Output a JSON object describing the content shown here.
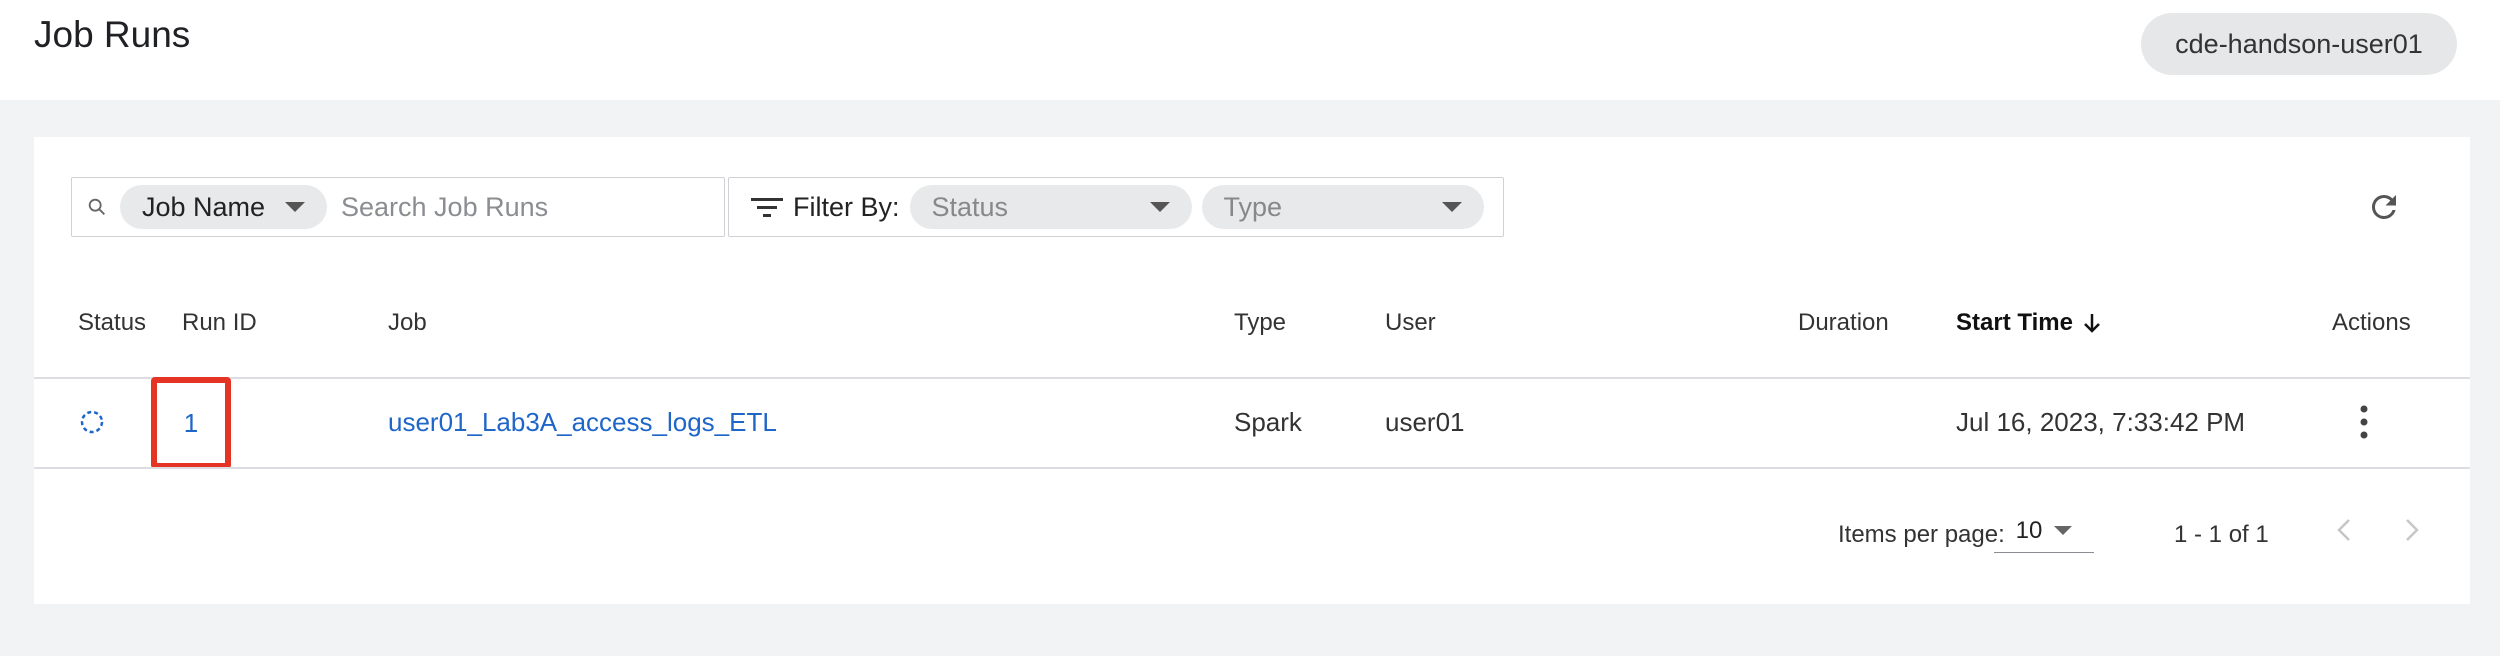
{
  "header": {
    "title": "Job Runs",
    "user": "cde-handson-user01"
  },
  "toolbar": {
    "search_field_select": "Job Name",
    "search_placeholder": "Search Job Runs",
    "filter_label": "Filter By:",
    "status_placeholder": "Status",
    "type_placeholder": "Type"
  },
  "table": {
    "columns": [
      "Status",
      "Run ID",
      "Job",
      "Type",
      "User",
      "Duration",
      "Start Time",
      "Actions"
    ],
    "sorted_column": "Start Time",
    "sort_direction": "descending",
    "rows": [
      {
        "status_icon": "running-spinner-icon",
        "run_id": "1",
        "job": "user01_Lab3A_access_logs_ETL",
        "type": "Spark",
        "user": "user01",
        "duration": "",
        "start_time": "Jul 16, 2023, 7:33:42 PM"
      }
    ]
  },
  "pagination": {
    "items_per_page_label": "Items per page:",
    "items_per_page": "10",
    "range": "1 - 1 of 1"
  },
  "colors": {
    "link": "#1f66c9",
    "highlight": "#e53324"
  }
}
